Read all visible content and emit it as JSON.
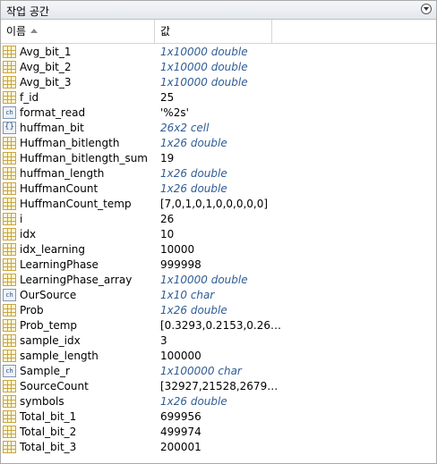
{
  "panel": {
    "title": "작업 공간"
  },
  "columns": {
    "name": "이름",
    "value": "값"
  },
  "variables": [
    {
      "icon": "matrix",
      "name": "Avg_bit_1",
      "value": "1x10000 double",
      "italic": true
    },
    {
      "icon": "matrix",
      "name": "Avg_bit_2",
      "value": "1x10000 double",
      "italic": true
    },
    {
      "icon": "matrix",
      "name": "Avg_bit_3",
      "value": "1x10000 double",
      "italic": true
    },
    {
      "icon": "matrix",
      "name": "f_id",
      "value": "25",
      "italic": false
    },
    {
      "icon": "char",
      "name": "format_read",
      "value": "'%2s'",
      "italic": false
    },
    {
      "icon": "cell",
      "name": "huffman_bit",
      "value": "26x2 cell",
      "italic": true
    },
    {
      "icon": "matrix",
      "name": "Huffman_bitlength",
      "value": "1x26 double",
      "italic": true
    },
    {
      "icon": "matrix",
      "name": "Huffman_bitlength_sum",
      "value": "19",
      "italic": false
    },
    {
      "icon": "matrix",
      "name": "huffman_length",
      "value": "1x26 double",
      "italic": true
    },
    {
      "icon": "matrix",
      "name": "HuffmanCount",
      "value": "1x26 double",
      "italic": true
    },
    {
      "icon": "matrix",
      "name": "HuffmanCount_temp",
      "value": "[7,0,1,0,1,0,0,0,0,0]",
      "italic": false
    },
    {
      "icon": "matrix",
      "name": "i",
      "value": "26",
      "italic": false
    },
    {
      "icon": "matrix",
      "name": "idx",
      "value": "10",
      "italic": false
    },
    {
      "icon": "matrix",
      "name": "idx_learning",
      "value": "10000",
      "italic": false
    },
    {
      "icon": "matrix",
      "name": "LearningPhase",
      "value": "999998",
      "italic": false
    },
    {
      "icon": "matrix",
      "name": "LearningPhase_array",
      "value": "1x10000 double",
      "italic": true
    },
    {
      "icon": "char",
      "name": "OurSource",
      "value": "1x10 char",
      "italic": true
    },
    {
      "icon": "matrix",
      "name": "Prob",
      "value": "1x26 double",
      "italic": true
    },
    {
      "icon": "matrix",
      "name": "Prob_temp",
      "value": "[0.3293,0.2153,0.26…",
      "italic": false
    },
    {
      "icon": "matrix",
      "name": "sample_idx",
      "value": "3",
      "italic": false
    },
    {
      "icon": "matrix",
      "name": "sample_length",
      "value": "100000",
      "italic": false
    },
    {
      "icon": "char",
      "name": "Sample_r",
      "value": "1x100000 char",
      "italic": true
    },
    {
      "icon": "matrix",
      "name": "SourceCount",
      "value": "[32927,21528,2679…",
      "italic": false
    },
    {
      "icon": "matrix",
      "name": "symbols",
      "value": "1x26 double",
      "italic": true
    },
    {
      "icon": "matrix",
      "name": "Total_bit_1",
      "value": "699956",
      "italic": false
    },
    {
      "icon": "matrix",
      "name": "Total_bit_2",
      "value": "499974",
      "italic": false
    },
    {
      "icon": "matrix",
      "name": "Total_bit_3",
      "value": "200001",
      "italic": false
    }
  ]
}
